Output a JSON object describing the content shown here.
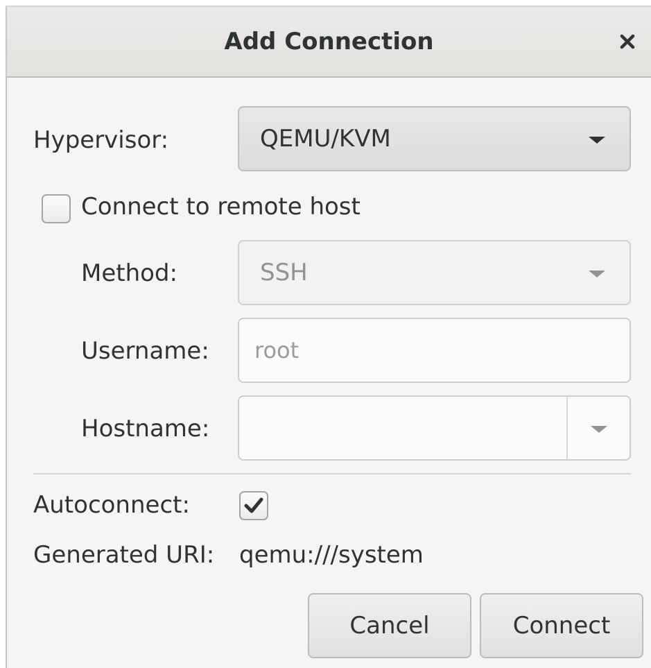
{
  "dialog": {
    "title": "Add Connection",
    "close_icon": "close-icon"
  },
  "hypervisor": {
    "label": "Hypervisor:",
    "value": "QEMU/KVM"
  },
  "remote": {
    "checkbox_label": "Connect to remote host",
    "checked": false
  },
  "method": {
    "label": "Method:",
    "value": "SSH"
  },
  "username": {
    "label": "Username:",
    "value": "root"
  },
  "hostname": {
    "label": "Hostname:",
    "value": ""
  },
  "autoconnect": {
    "label": "Autoconnect:",
    "checked": true
  },
  "uri": {
    "label": "Generated URI:",
    "value": "qemu:///system"
  },
  "buttons": {
    "cancel": "Cancel",
    "connect": "Connect"
  },
  "colors": {
    "text": "#2e3436",
    "disabled_text": "#8f9392",
    "dialog_bg": "#f6f5f4"
  }
}
